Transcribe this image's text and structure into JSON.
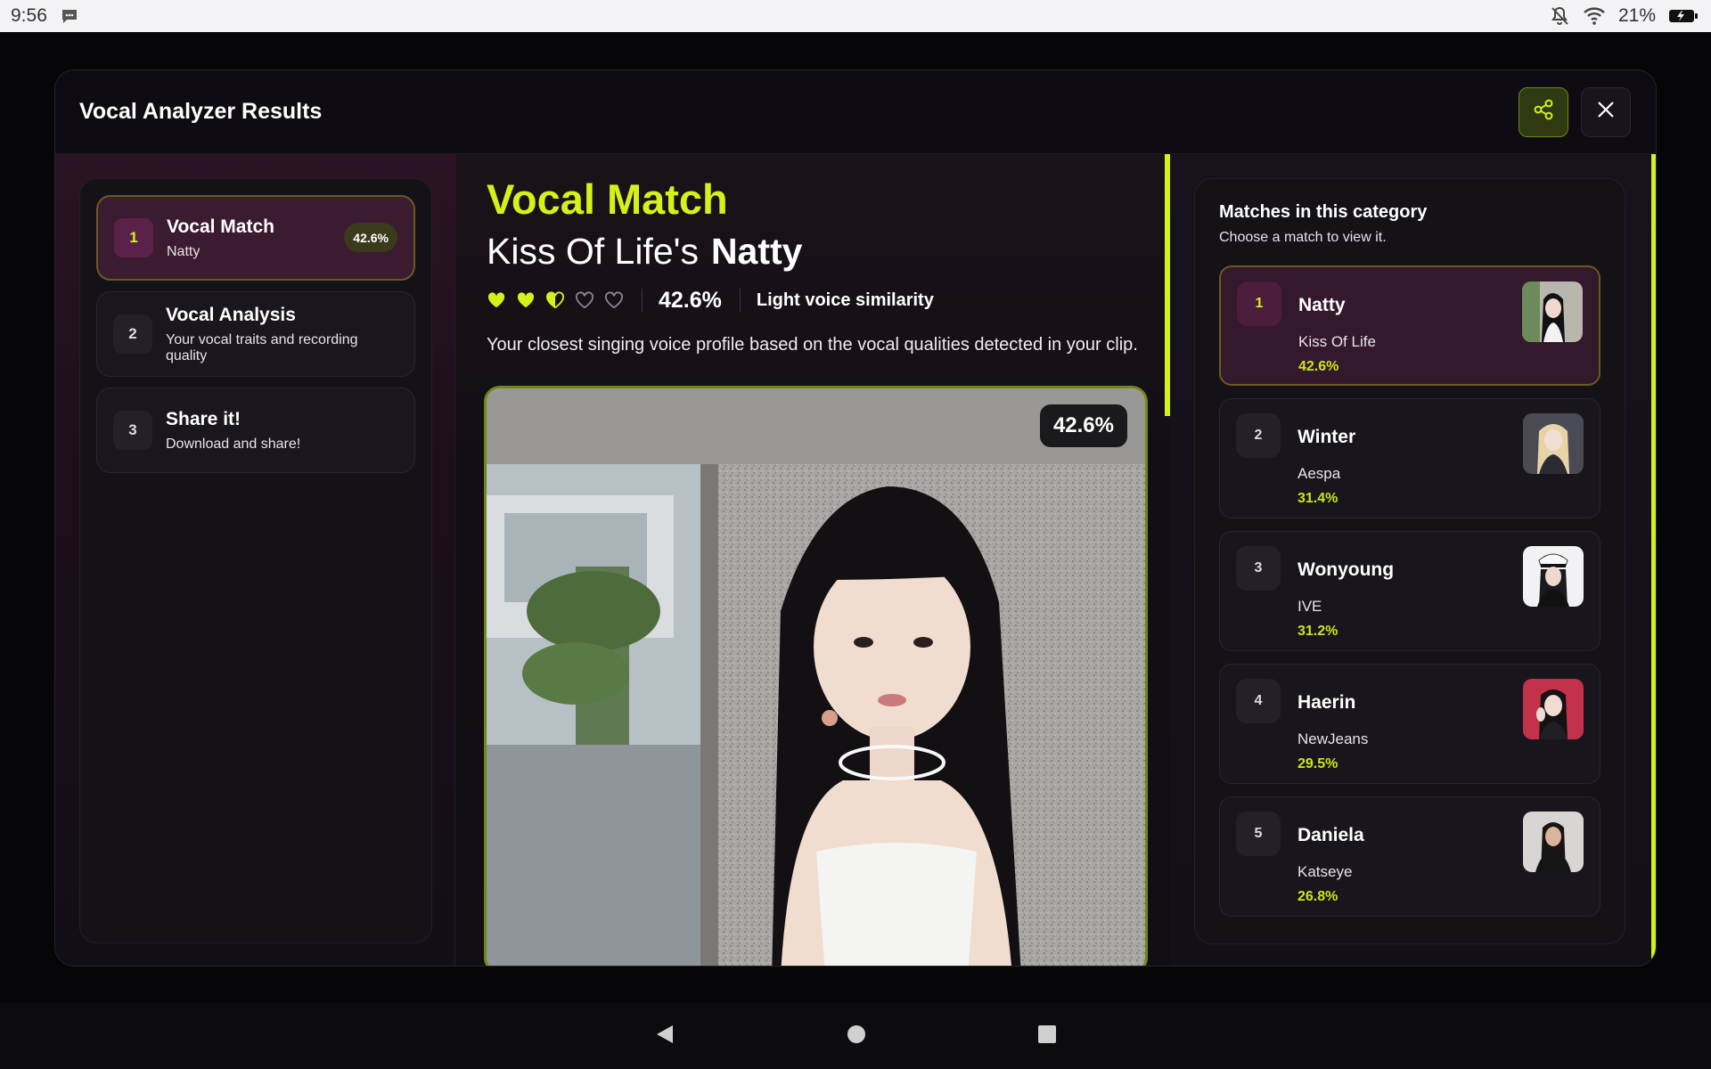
{
  "status": {
    "time": "9:56",
    "battery": "21%"
  },
  "modal": {
    "title": "Vocal Analyzer Results"
  },
  "steps": [
    {
      "num": "1",
      "title": "Vocal Match",
      "sub": "Natty",
      "badge": "42.6%"
    },
    {
      "num": "2",
      "title": "Vocal Analysis",
      "sub": "Your vocal traits and recording quality"
    },
    {
      "num": "3",
      "title": "Share it!",
      "sub": "Download and share!"
    }
  ],
  "main": {
    "heading": "Vocal Match",
    "group": "Kiss Of Life's",
    "name": "Natty",
    "hearts": {
      "filled": 2,
      "half": 1,
      "total": 5
    },
    "percent": "42.6%",
    "similarity": "Light voice similarity",
    "description": "Your closest singing voice profile based on the vocal qualities detected in your clip.",
    "photo_badge": "42.6%"
  },
  "matches": {
    "title": "Matches in this category",
    "subtitle": "Choose a match to view it.",
    "items": [
      {
        "num": "1",
        "name": "Natty",
        "group": "Kiss Of Life",
        "pct": "42.6%"
      },
      {
        "num": "2",
        "name": "Winter",
        "group": "Aespa",
        "pct": "31.4%"
      },
      {
        "num": "3",
        "name": "Wonyoung",
        "group": "IVE",
        "pct": "31.2%"
      },
      {
        "num": "4",
        "name": "Haerin",
        "group": "NewJeans",
        "pct": "29.5%"
      },
      {
        "num": "5",
        "name": "Daniela",
        "group": "Katseye",
        "pct": "26.8%"
      }
    ]
  },
  "colors": {
    "accent": "#d4f11a",
    "plum": "#3a1b2f",
    "panel": "#141117"
  }
}
